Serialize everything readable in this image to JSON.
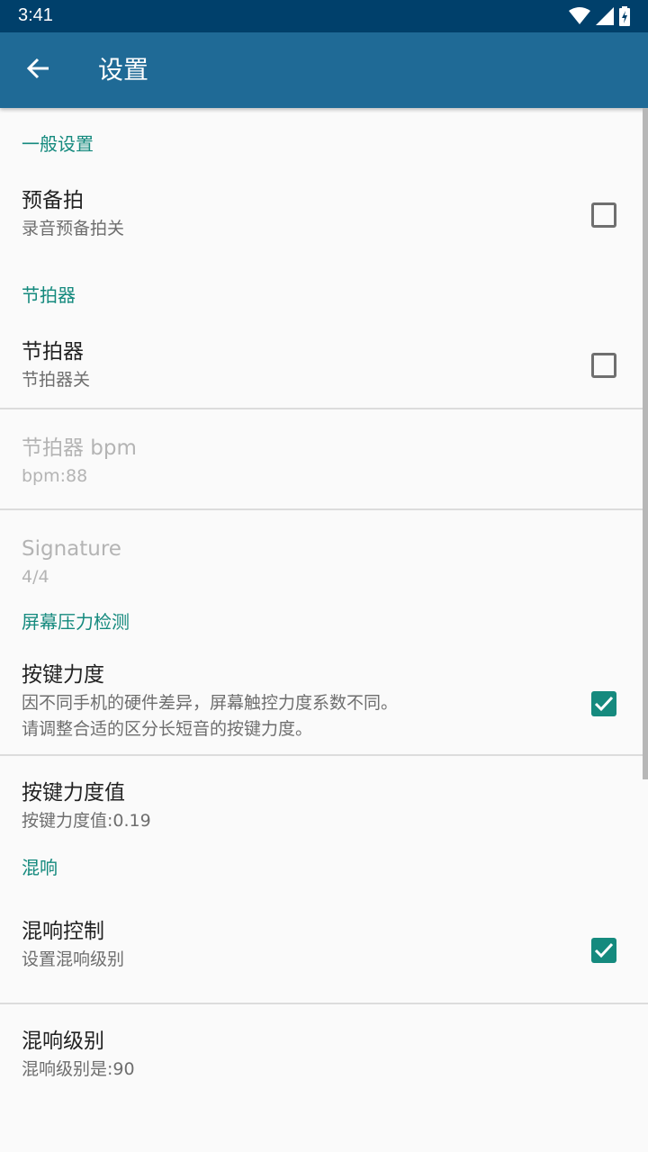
{
  "status_bar": {
    "time": "3:41",
    "icons": [
      "wifi-icon",
      "cell-signal-icon",
      "battery-charging-icon"
    ]
  },
  "app_bar": {
    "back_icon": "arrow-left-icon",
    "title": "设置"
  },
  "sections": {
    "general": {
      "header": "一般设置",
      "countin": {
        "title": "预备拍",
        "summary": "录音预备拍关",
        "checked": false
      }
    },
    "metronome": {
      "header": "节拍器",
      "toggle": {
        "title": "节拍器",
        "summary": "节拍器关",
        "checked": false
      },
      "bpm": {
        "title": "节拍器 bpm",
        "summary": "bpm:88",
        "enabled": false
      },
      "signature": {
        "title": "Signature",
        "summary": "4/4",
        "enabled": false
      }
    },
    "pressure": {
      "header": "屏幕压力检测",
      "toggle": {
        "title": "按键力度",
        "summary_line1": "因不同手机的硬件差异，屏幕触控力度系数不同。",
        "summary_line2": "请调整合适的区分长短音的按键力度。",
        "checked": true
      },
      "value": {
        "title": "按键力度值",
        "summary": "按键力度值:0.19"
      }
    },
    "reverb": {
      "header": "混响",
      "toggle": {
        "title": "混响控制",
        "summary": "设置混响级别",
        "checked": true
      },
      "level": {
        "title": "混响级别",
        "summary": "混响级别是:90"
      }
    }
  },
  "colors": {
    "status_bar": "#00406b",
    "app_bar": "#1f6a96",
    "accent": "#158a7e",
    "background": "#fafafa"
  }
}
